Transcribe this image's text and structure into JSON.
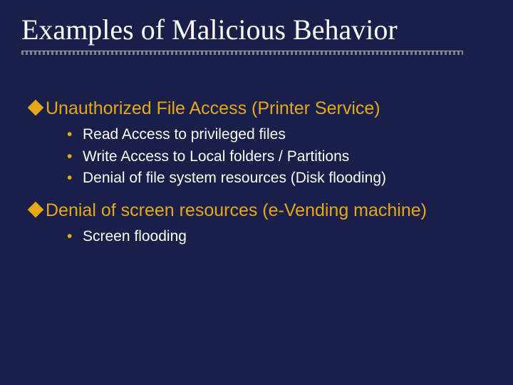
{
  "title": "Examples of Malicious Behavior",
  "sections": [
    {
      "heading": "Unauthorized File Access (Printer Service)",
      "items": [
        "Read Access to privileged files",
        "Write Access to Local folders / Partitions",
        "Denial of file system resources (Disk flooding)"
      ]
    },
    {
      "heading": "Denial of screen resources (e-Vending machine)",
      "items": [
        "Screen flooding"
      ]
    }
  ]
}
